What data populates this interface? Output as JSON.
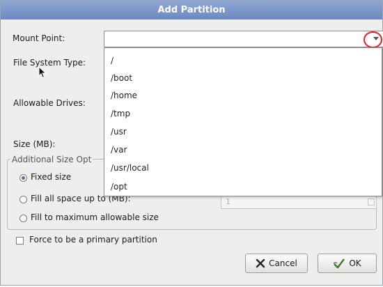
{
  "window": {
    "title": "Add Partition"
  },
  "form": {
    "mount_point_label": "Mount Point:",
    "file_system_type_label": "File System Type:",
    "allowable_drives_label": "Allowable Drives:",
    "size_label": "Size (MB):",
    "mount_point_value": ""
  },
  "mount_dropdown": {
    "options": [
      "/",
      "/boot",
      "/home",
      "/tmp",
      "/usr",
      "/var",
      "/usr/local",
      "/opt"
    ]
  },
  "additional_size": {
    "legend": "Additional Size Opt",
    "fixed_label": "Fixed size",
    "fill_upto_label": "Fill all space up to (MB):",
    "fill_max_label": "Fill to maximum allowable size",
    "fill_upto_value": "1",
    "selected": "fixed"
  },
  "force_primary": {
    "label": "Force to be a primary partition",
    "checked": false
  },
  "buttons": {
    "cancel": "Cancel",
    "ok": "OK"
  },
  "colors": {
    "titlebar": "#7a95c9",
    "highlight_circle": "#e0201b",
    "dialog_bg": "#eeeeec"
  },
  "icons": {
    "cancel": "cancel-x-icon",
    "ok": "ok-check-icon",
    "cursor": "mouse-pointer-icon"
  }
}
